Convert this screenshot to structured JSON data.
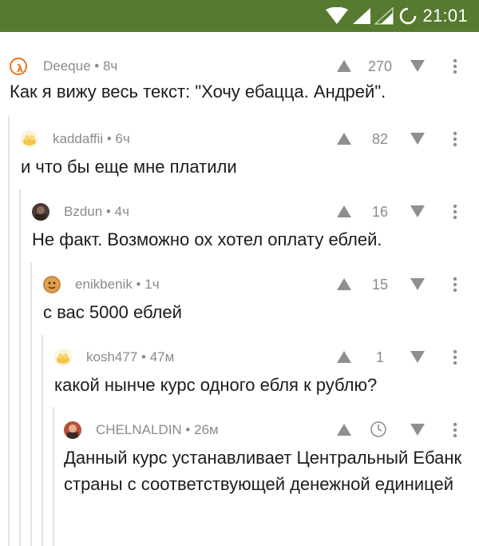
{
  "status_bar": {
    "time": "21:01"
  },
  "comments": [
    {
      "author": "Deeque",
      "age": "8ч",
      "rating": "270",
      "text": "Как я вижу весь текст: \"Хочу ебацца. Андрей\"."
    },
    {
      "author": "kaddaffii",
      "age": "6ч",
      "rating": "82",
      "text": "и что бы еще мне платили"
    },
    {
      "author": "Bzdun",
      "age": "4ч",
      "rating": "16",
      "text": "Не факт. Возможно ох хотел оплату еблей."
    },
    {
      "author": "enikbenik",
      "age": "1ч",
      "rating": "15",
      "text": "с вас 5000 еблей"
    },
    {
      "author": "kosh477",
      "age": "47м",
      "rating": "1",
      "text": "какой нынче курс одного ебля к рублю?"
    },
    {
      "author": "CHELNALDIN",
      "age": "26м",
      "rating": "",
      "rating_icon": "clock-icon",
      "text": "Данный курс устанавливает Центральный Ебанк страны с соответствующей денежной единицей"
    }
  ],
  "colors": {
    "status_bar": "#567a2f",
    "meta": "#8a8a8a",
    "text": "#1c1c1c",
    "thread_line": "#e2e2e2"
  }
}
